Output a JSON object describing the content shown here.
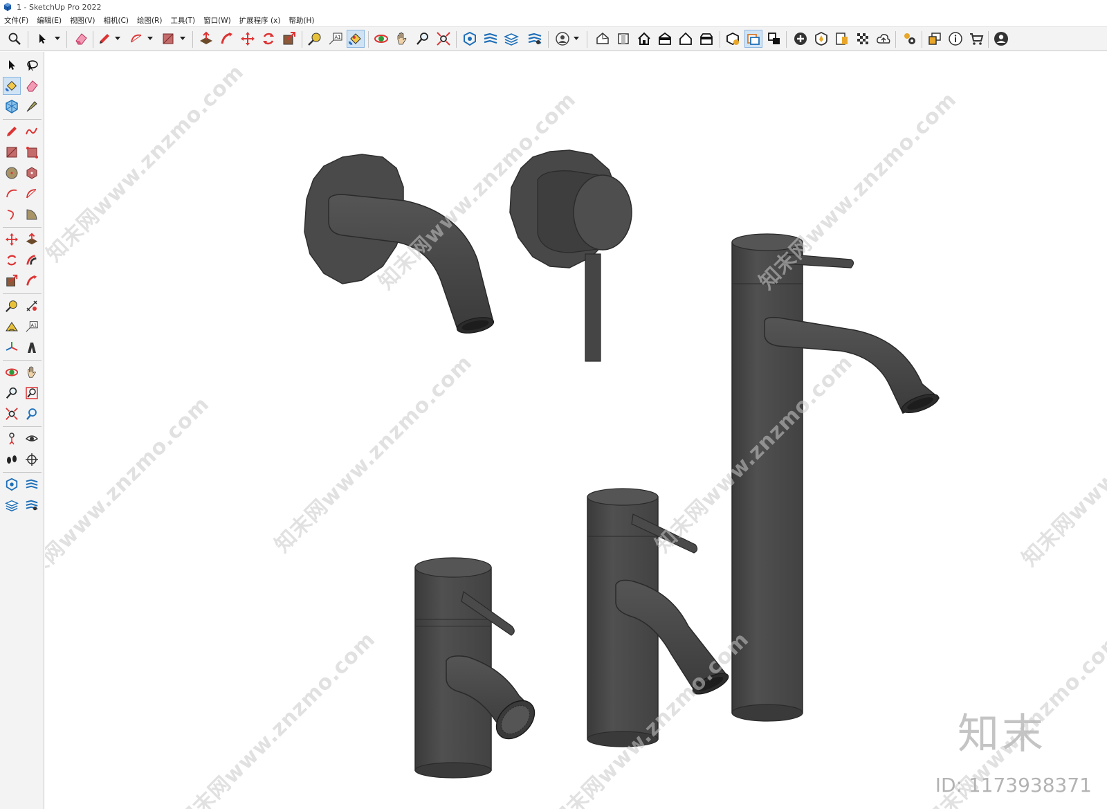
{
  "window": {
    "title": "1 - SketchUp Pro 2022"
  },
  "menu": [
    "文件(F)",
    "编辑(E)",
    "视图(V)",
    "相机(C)",
    "绘图(R)",
    "工具(T)",
    "窗口(W)",
    "扩展程序 (x)",
    "帮助(H)"
  ],
  "toolbar": {
    "icons": [
      "zoom-icon",
      "select-icon",
      "eraser-icon",
      "pencil-icon",
      "arc-icon",
      "rectangle-icon",
      "push-pull-icon",
      "follow-me-icon",
      "move-icon",
      "rotate-icon",
      "scale-icon",
      "tape-measure-icon",
      "text-icon",
      "paint-bucket-icon",
      "orbit-icon",
      "pan-icon",
      "zoom-window-icon",
      "zoom-extents-icon",
      "tags-icon",
      "scenes-icon",
      "styles-icon",
      "outliner-icon",
      "user-icon",
      "iso-view-icon",
      "front-view-icon",
      "home-view-icon",
      "left-view-icon",
      "back-view-icon",
      "right-view-icon",
      "3d-warehouse-icon",
      "extension-warehouse-icon",
      "layout-icon",
      "add-location-icon",
      "sandbox-icon",
      "classifier-icon",
      "generate-report-icon",
      "solid-tools-icon",
      "cloud-icon",
      "preferences-icon",
      "open-model-icon",
      "info-icon",
      "cart-icon",
      "account-icon"
    ],
    "active": "paint-bucket-icon"
  },
  "lefttoolbar": {
    "active": "paint-bucket-icon"
  },
  "viewport": {
    "watermark_text": "知末网www.znzmo.com",
    "brand_logo": "知末",
    "brand_id": "ID: 1173938371",
    "model_color": "#4a4a4a"
  },
  "colors": {
    "toolbar_bg": "#f3f3f3",
    "viewport_bg": "#ffffff",
    "active_bg": "#cfe3f5",
    "faucet_dark": "#3e3e3e",
    "faucet_mid": "#4f4f4f",
    "faucet_light": "#5c5c5c"
  }
}
